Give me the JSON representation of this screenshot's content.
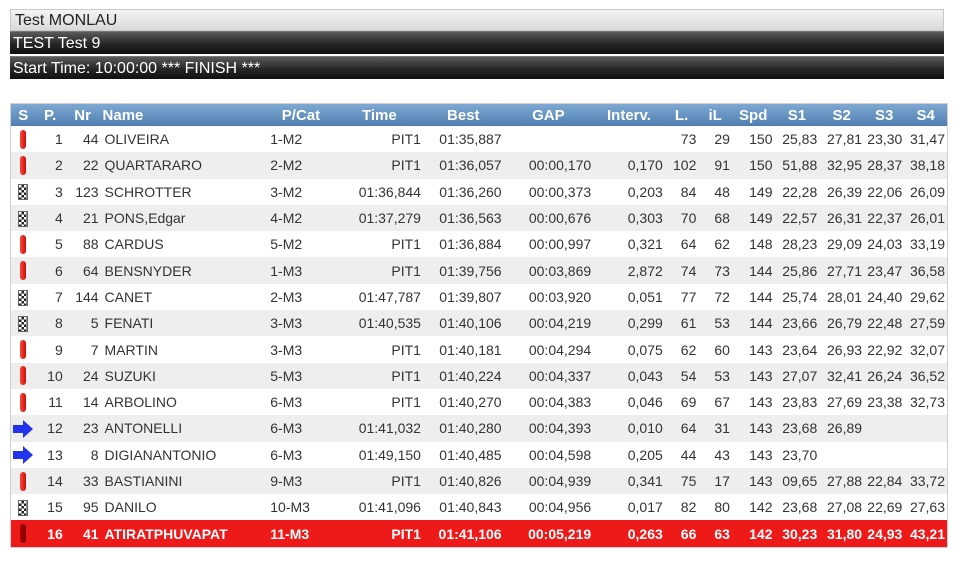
{
  "event": {
    "title": "Test MONLAU"
  },
  "session": {
    "title": "TEST Test 9"
  },
  "status": {
    "text": "Start Time: 10:00:00 *** FINISH ***"
  },
  "columns": [
    "S",
    "P.",
    "Nr",
    "Name",
    "P/Cat",
    "Time",
    "Best",
    "GAP",
    "Interv.",
    "L.",
    "iL",
    "Spd",
    "S1",
    "S2",
    "S3",
    "S4"
  ],
  "rows": [
    {
      "s": "pit",
      "p": "1",
      "nr": "44",
      "name": "OLIVEIRA",
      "cat": "1-M2",
      "time": "PIT1",
      "best": "01:35,887",
      "gap": "",
      "int": "",
      "l": "73",
      "il": "29",
      "spd": "150",
      "s1": "25,83",
      "s2": "27,81",
      "s3": "23,30",
      "s4": "31,47"
    },
    {
      "s": "pit",
      "p": "2",
      "nr": "22",
      "name": "QUARTARARO",
      "cat": "2-M2",
      "time": "PIT1",
      "best": "01:36,057",
      "gap": "00:00,170",
      "int": "0,170",
      "l": "102",
      "il": "91",
      "spd": "150",
      "s1": "51,88",
      "s2": "32,95",
      "s3": "28,37",
      "s4": "38,18"
    },
    {
      "s": "flag",
      "p": "3",
      "nr": "123",
      "name": "SCHROTTER",
      "cat": "3-M2",
      "time": "01:36,844",
      "best": "01:36,260",
      "gap": "00:00,373",
      "int": "0,203",
      "l": "84",
      "il": "48",
      "spd": "149",
      "s1": "22,28",
      "s2": "26,39",
      "s3": "22,06",
      "s4": "26,09"
    },
    {
      "s": "flag",
      "p": "4",
      "nr": "21",
      "name": "PONS,Edgar",
      "cat": "4-M2",
      "time": "01:37,279",
      "best": "01:36,563",
      "gap": "00:00,676",
      "int": "0,303",
      "l": "70",
      "il": "68",
      "spd": "149",
      "s1": "22,57",
      "s2": "26,31",
      "s3": "22,37",
      "s4": "26,01"
    },
    {
      "s": "pit",
      "p": "5",
      "nr": "88",
      "name": "CARDUS",
      "cat": "5-M2",
      "time": "PIT1",
      "best": "01:36,884",
      "gap": "00:00,997",
      "int": "0,321",
      "l": "64",
      "il": "62",
      "spd": "148",
      "s1": "28,23",
      "s2": "29,09",
      "s3": "24,03",
      "s4": "33,19"
    },
    {
      "s": "pit",
      "p": "6",
      "nr": "64",
      "name": "BENSNYDER",
      "cat": "1-M3",
      "time": "PIT1",
      "best": "01:39,756",
      "gap": "00:03,869",
      "int": "2,872",
      "l": "74",
      "il": "73",
      "spd": "144",
      "s1": "25,86",
      "s2": "27,71",
      "s3": "23,47",
      "s4": "36,58"
    },
    {
      "s": "flag",
      "p": "7",
      "nr": "144",
      "name": "CANET",
      "cat": "2-M3",
      "time": "01:47,787",
      "best": "01:39,807",
      "gap": "00:03,920",
      "int": "0,051",
      "l": "77",
      "il": "72",
      "spd": "144",
      "s1": "25,74",
      "s2": "28,01",
      "s3": "24,40",
      "s4": "29,62"
    },
    {
      "s": "flag",
      "p": "8",
      "nr": "5",
      "name": "FENATI",
      "cat": "3-M3",
      "time": "01:40,535",
      "best": "01:40,106",
      "gap": "00:04,219",
      "int": "0,299",
      "l": "61",
      "il": "53",
      "spd": "144",
      "s1": "23,66",
      "s2": "26,79",
      "s3": "22,48",
      "s4": "27,59"
    },
    {
      "s": "pit",
      "p": "9",
      "nr": "7",
      "name": "MARTIN",
      "cat": "3-M3",
      "time": "PIT1",
      "best": "01:40,181",
      "gap": "00:04,294",
      "int": "0,075",
      "l": "62",
      "il": "60",
      "spd": "143",
      "s1": "23,64",
      "s2": "26,93",
      "s3": "22,92",
      "s4": "32,07"
    },
    {
      "s": "pit",
      "p": "10",
      "nr": "24",
      "name": "SUZUKI",
      "cat": "5-M3",
      "time": "PIT1",
      "best": "01:40,224",
      "gap": "00:04,337",
      "int": "0,043",
      "l": "54",
      "il": "53",
      "spd": "143",
      "s1": "27,07",
      "s2": "32,41",
      "s3": "26,24",
      "s4": "36,52"
    },
    {
      "s": "pit",
      "p": "11",
      "nr": "14",
      "name": "ARBOLINO",
      "cat": "6-M3",
      "time": "PIT1",
      "best": "01:40,270",
      "gap": "00:04,383",
      "int": "0,046",
      "l": "69",
      "il": "67",
      "spd": "143",
      "s1": "23,83",
      "s2": "27,69",
      "s3": "23,38",
      "s4": "32,73"
    },
    {
      "s": "arrow",
      "p": "12",
      "nr": "23",
      "name": "ANTONELLI",
      "cat": "6-M3",
      "time": "01:41,032",
      "best": "01:40,280",
      "gap": "00:04,393",
      "int": "0,010",
      "l": "64",
      "il": "31",
      "spd": "143",
      "s1": "23,68",
      "s2": "26,89",
      "s3": "",
      "s4": ""
    },
    {
      "s": "arrow",
      "p": "13",
      "nr": "8",
      "name": "DIGIANANTONIO",
      "cat": "6-M3",
      "time": "01:49,150",
      "best": "01:40,485",
      "gap": "00:04,598",
      "int": "0,205",
      "l": "44",
      "il": "43",
      "spd": "143",
      "s1": "23,70",
      "s2": "",
      "s3": "",
      "s4": ""
    },
    {
      "s": "pit",
      "p": "14",
      "nr": "33",
      "name": "BASTIANINI",
      "cat": "9-M3",
      "time": "PIT1",
      "best": "01:40,826",
      "gap": "00:04,939",
      "int": "0,341",
      "l": "75",
      "il": "17",
      "spd": "143",
      "s1": "09,65",
      "s2": "27,88",
      "s3": "22,84",
      "s4": "33,72"
    },
    {
      "s": "flag",
      "p": "15",
      "nr": "95",
      "name": "DANILO",
      "cat": "10-M3",
      "time": "01:41,096",
      "best": "01:40,843",
      "gap": "00:04,956",
      "int": "0,017",
      "l": "82",
      "il": "80",
      "spd": "142",
      "s1": "23,68",
      "s2": "27,08",
      "s3": "22,69",
      "s4": "27,63"
    },
    {
      "s": "pit",
      "p": "16",
      "nr": "41",
      "name": "ATIRATPHUVAPAT",
      "cat": "11-M3",
      "time": "PIT1",
      "best": "01:41,106",
      "gap": "00:05,219",
      "int": "0,263",
      "l": "66",
      "il": "63",
      "spd": "142",
      "s1": "30,23",
      "s2": "31,80",
      "s3": "24,93",
      "s4": "43,21",
      "highlight": true
    }
  ],
  "colors": {
    "header": "#5f8fc1",
    "highlight": "#ee1a1a",
    "pit": "#e02020",
    "arrow": "#2233ee"
  },
  "icons": {
    "pit": "pit-status-icon",
    "flag": "checkered-flag-icon",
    "arrow": "right-arrow-icon"
  }
}
